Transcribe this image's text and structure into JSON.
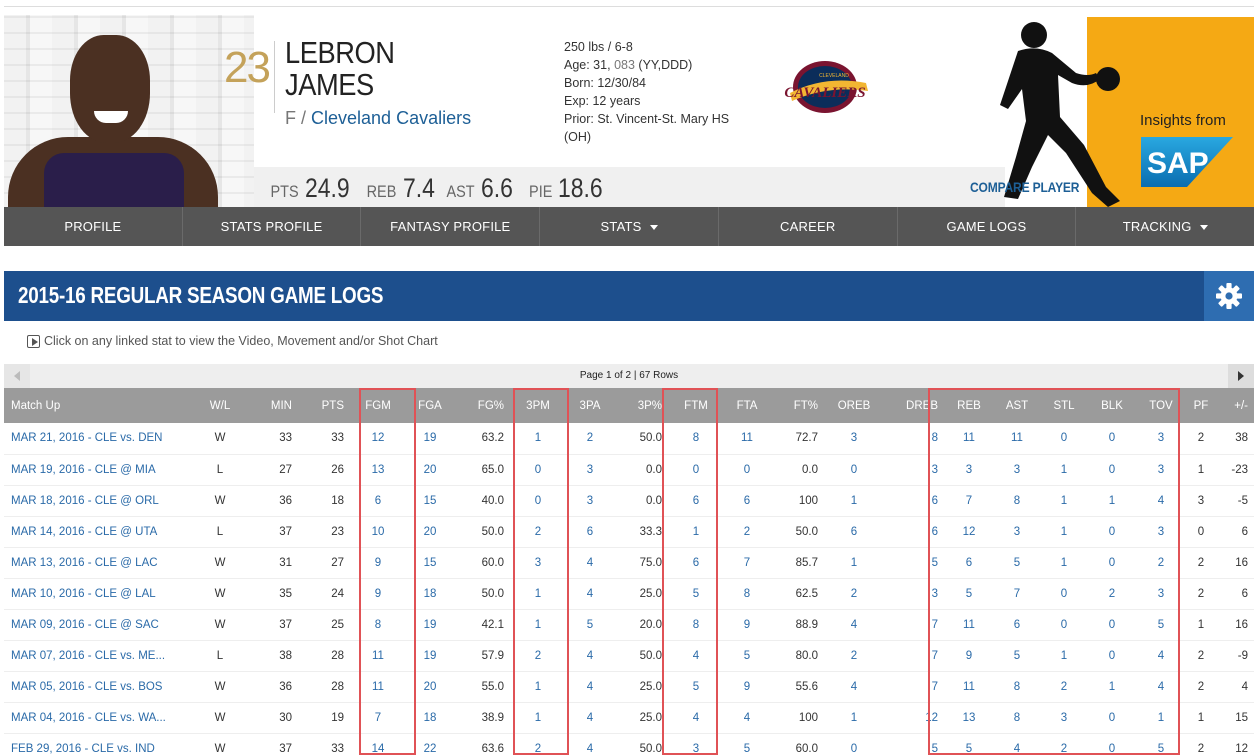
{
  "player": {
    "number": "23",
    "first_name": "LEBRON",
    "last_name": "JAMES",
    "position": "F /",
    "team": "Cleveland Cavaliers",
    "bio": {
      "weight_height": "250 lbs / 6-8",
      "age_prefix": "Age: 31,",
      "age_days": "083",
      "age_suffix": "(YY,DDD)",
      "born": "Born: 12/30/84",
      "exp": "Exp: 12 years",
      "prior": "Prior: St. Vincent-St. Mary HS (OH)"
    },
    "stats": [
      {
        "label": "PTS",
        "value": "24.9"
      },
      {
        "label": "REB",
        "value": "7.4"
      },
      {
        "label": "AST",
        "value": "6.6"
      },
      {
        "label": "PIE",
        "value": "18.6"
      }
    ],
    "compare": "COMPARE PLAYER",
    "sponsor_text": "Insights from",
    "sponsor_logo_text": "SAP",
    "team_logo_text": "CAVALIERS",
    "team_logo_city": "CLEVELAND"
  },
  "nav": [
    "PROFILE",
    "STATS PROFILE",
    "FANTASY PROFILE",
    "STATS",
    "CAREER",
    "GAME LOGS",
    "TRACKING"
  ],
  "section": {
    "title": "2015-16 REGULAR SEASON GAME LOGS",
    "hint": "Click on any linked stat to view the Video, Movement and/or Shot Chart",
    "pager": "Page 1 of 2 | 67 Rows"
  },
  "table": {
    "columns": [
      "Match Up",
      "W/L",
      "MIN",
      "PTS",
      "FGM",
      "FGA",
      "FG%",
      "3PM",
      "3PA",
      "3P%",
      "FTM",
      "FTA",
      "FT%",
      "OREB",
      "DREB",
      "REB",
      "AST",
      "STL",
      "BLK",
      "TOV",
      "PF",
      "+/-"
    ],
    "rows": [
      [
        "MAR 21, 2016 - CLE vs. DEN",
        "W",
        "33",
        "33",
        "12",
        "19",
        "63.2",
        "1",
        "2",
        "50.0",
        "8",
        "11",
        "72.7",
        "3",
        "8",
        "11",
        "11",
        "0",
        "0",
        "3",
        "2",
        "38"
      ],
      [
        "MAR 19, 2016 - CLE @ MIA",
        "L",
        "27",
        "26",
        "13",
        "20",
        "65.0",
        "0",
        "3",
        "0.0",
        "0",
        "0",
        "0.0",
        "0",
        "3",
        "3",
        "3",
        "1",
        "0",
        "3",
        "1",
        "-23"
      ],
      [
        "MAR 18, 2016 - CLE @ ORL",
        "W",
        "36",
        "18",
        "6",
        "15",
        "40.0",
        "0",
        "3",
        "0.0",
        "6",
        "6",
        "100",
        "1",
        "6",
        "7",
        "8",
        "1",
        "1",
        "4",
        "3",
        "-5"
      ],
      [
        "MAR 14, 2016 - CLE @ UTA",
        "L",
        "37",
        "23",
        "10",
        "20",
        "50.0",
        "2",
        "6",
        "33.3",
        "1",
        "2",
        "50.0",
        "6",
        "6",
        "12",
        "3",
        "1",
        "0",
        "3",
        "0",
        "6"
      ],
      [
        "MAR 13, 2016 - CLE @ LAC",
        "W",
        "31",
        "27",
        "9",
        "15",
        "60.0",
        "3",
        "4",
        "75.0",
        "6",
        "7",
        "85.7",
        "1",
        "5",
        "6",
        "5",
        "1",
        "0",
        "2",
        "2",
        "16"
      ],
      [
        "MAR 10, 2016 - CLE @ LAL",
        "W",
        "35",
        "24",
        "9",
        "18",
        "50.0",
        "1",
        "4",
        "25.0",
        "5",
        "8",
        "62.5",
        "2",
        "3",
        "5",
        "7",
        "0",
        "2",
        "3",
        "2",
        "6"
      ],
      [
        "MAR 09, 2016 - CLE @ SAC",
        "W",
        "37",
        "25",
        "8",
        "19",
        "42.1",
        "1",
        "5",
        "20.0",
        "8",
        "9",
        "88.9",
        "4",
        "7",
        "11",
        "6",
        "0",
        "0",
        "5",
        "1",
        "16"
      ],
      [
        "MAR 07, 2016 - CLE vs. ME...",
        "L",
        "38",
        "28",
        "11",
        "19",
        "57.9",
        "2",
        "4",
        "50.0",
        "4",
        "5",
        "80.0",
        "2",
        "7",
        "9",
        "5",
        "1",
        "0",
        "4",
        "2",
        "-9"
      ],
      [
        "MAR 05, 2016 - CLE vs. BOS",
        "W",
        "36",
        "28",
        "11",
        "20",
        "55.0",
        "1",
        "4",
        "25.0",
        "5",
        "9",
        "55.6",
        "4",
        "7",
        "11",
        "8",
        "2",
        "1",
        "4",
        "2",
        "4"
      ],
      [
        "MAR 04, 2016 - CLE vs. WA...",
        "W",
        "30",
        "19",
        "7",
        "18",
        "38.9",
        "1",
        "4",
        "25.0",
        "4",
        "4",
        "100",
        "1",
        "12",
        "13",
        "8",
        "3",
        "0",
        "1",
        "1",
        "15"
      ],
      [
        "FEB 29, 2016 - CLE vs. IND",
        "W",
        "37",
        "33",
        "14",
        "22",
        "63.6",
        "2",
        "4",
        "50.0",
        "3",
        "5",
        "60.0",
        "0",
        "5",
        "5",
        "4",
        "2",
        "0",
        "5",
        "2",
        "12"
      ]
    ]
  },
  "colors": {
    "header_blue": "#1d4f8d",
    "link_blue": "#2a6aa8",
    "nav_gray": "#555555",
    "highlight_red": "#e05256",
    "sap_gold": "#f5a914",
    "number_gold": "#c4a25a"
  }
}
